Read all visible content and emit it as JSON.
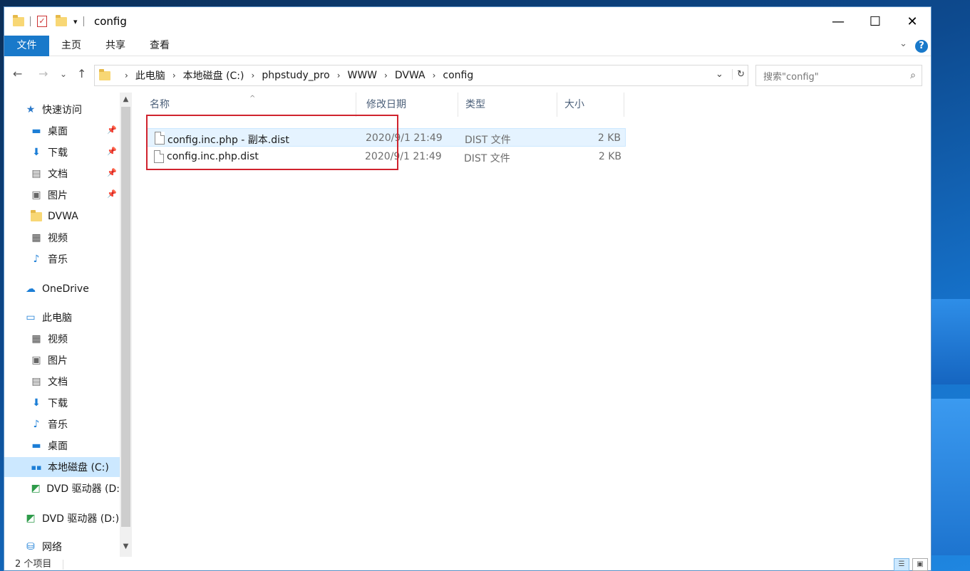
{
  "window": {
    "title": "config",
    "controls": {
      "minimize": "—",
      "maximize": "☐",
      "close": "✕"
    }
  },
  "ribbon": {
    "tabs": [
      "文件",
      "主页",
      "共享",
      "查看"
    ],
    "expand": "⌄",
    "help": "?"
  },
  "address": {
    "crumbs": [
      "此电脑",
      "本地磁盘 (C:)",
      "phpstudy_pro",
      "WWW",
      "DVWA",
      "config"
    ],
    "separator": "›",
    "dropdown": "⌄",
    "refresh": "↻"
  },
  "search": {
    "placeholder": "搜索\"config\"",
    "icon": "⌕"
  },
  "nav": {
    "back": "←",
    "forward": "→",
    "recent": "⌄",
    "up": "↑",
    "quick_access": "快速访问",
    "items": [
      {
        "label": "桌面",
        "icon": "desktop-icon",
        "pinned": true
      },
      {
        "label": "下载",
        "icon": "download-icon",
        "pinned": true
      },
      {
        "label": "文档",
        "icon": "document-icon",
        "pinned": true
      },
      {
        "label": "图片",
        "icon": "picture-icon",
        "pinned": true
      },
      {
        "label": "DVWA",
        "icon": "folder-icon",
        "pinned": false
      },
      {
        "label": "视频",
        "icon": "video-icon",
        "pinned": false
      },
      {
        "label": "音乐",
        "icon": "music-icon",
        "pinned": false
      }
    ],
    "onedrive": "OneDrive",
    "this_pc": "此电脑",
    "pc_items": [
      {
        "label": "视频",
        "icon": "video-icon"
      },
      {
        "label": "图片",
        "icon": "picture-icon"
      },
      {
        "label": "文档",
        "icon": "document-icon"
      },
      {
        "label": "下载",
        "icon": "download-icon"
      },
      {
        "label": "音乐",
        "icon": "music-icon"
      },
      {
        "label": "桌面",
        "icon": "desktop-icon"
      },
      {
        "label": "本地磁盘 (C:)",
        "icon": "drive-icon"
      },
      {
        "label": "DVD 驱动器 (D:",
        "icon": "dvd-icon"
      }
    ],
    "dvd": "DVD 驱动器 (D:)",
    "network": "网络"
  },
  "columns": {
    "name": "名称",
    "modified": "修改日期",
    "type": "类型",
    "size": "大小"
  },
  "files": [
    {
      "name": "config.inc.php - 副本.dist",
      "modified": "2020/9/1 21:49",
      "type": "DIST 文件",
      "size": "2 KB"
    },
    {
      "name": "config.inc.php.dist",
      "modified": "2020/9/1 21:49",
      "type": "DIST 文件",
      "size": "2 KB"
    }
  ],
  "status": {
    "count": "2 个项目"
  },
  "colors": {
    "accent": "#1979ca",
    "selection": "#cce8ff",
    "annotation": "#d0232e"
  }
}
